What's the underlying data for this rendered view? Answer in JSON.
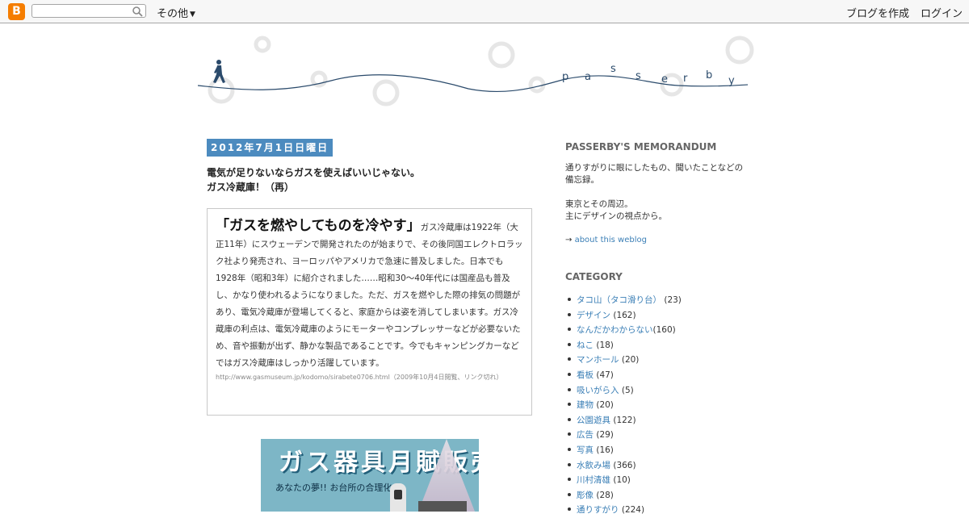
{
  "navbar": {
    "logo": "B",
    "search_placeholder": "",
    "more_label": "その他",
    "create_blog_label": "ブログを作成",
    "login_label": "ログイン"
  },
  "header": {
    "title": "p   a   s   s   e   r   b   y"
  },
  "post": {
    "date": "2012年7月1日日曜日",
    "title_line1": "電気が足りないならガスを使えばいいじゃない。",
    "title_line2": "ガス冷蔵庫！（再）",
    "quote_lead": "「ガスを燃やしてものを冷やす」",
    "quote_body": "ガス冷蔵庫は1922年（大正11年）にスウェーデンで開発されたのが始まりで、その後同国エレクトロラック社より発売され、ヨーロッパやアメリカで急速に普及しました。日本でも1928年（昭和3年）に紹介されました……昭和30～40年代には国産品も普及し、かなり使われるようになりました。ただ、ガスを燃やした際の排気の問題があり、電気冷蔵庫が登場してくると、家庭からは姿を消してしまいます。ガス冷蔵庫の利点は、電気冷蔵庫のようにモーターやコンプレッサーなどが必要ないため、音や振動が出ず、静かな製品であることです。今でもキャンピングカーなどではガス冷蔵庫はしっかり活躍しています。",
    "quote_source": "http://www.gasmuseum.jp/kodomo/sirabete0706.html（2009年10月4日閲覧、リンク切れ）",
    "poster_title": "ガス器具月賦販売",
    "poster_sub": "あなたの夢!! お台所の合理化を"
  },
  "sidebar": {
    "about_title": "PASSERBY'S MEMORANDUM",
    "about_line1": "通りすがりに眼にしたもの、聞いたことなどの備忘録。",
    "about_line2": "東京とその周辺。",
    "about_line3": "主にデザインの視点から。",
    "about_arrow": "→",
    "about_link": "about this weblog",
    "category_title": "CATEGORY",
    "categories": [
      {
        "name": "タコ山（タコ滑り台）",
        "count": "(23)"
      },
      {
        "name": "デザイン",
        "count": "(162)"
      },
      {
        "name": "なんだかわからない",
        "count": "(160)"
      },
      {
        "name": "ねこ",
        "count": "(18)"
      },
      {
        "name": "マンホール",
        "count": "(20)"
      },
      {
        "name": "看板",
        "count": "(47)"
      },
      {
        "name": "吸いがら入",
        "count": "(5)"
      },
      {
        "name": "建物",
        "count": "(20)"
      },
      {
        "name": "公園遊具",
        "count": "(122)"
      },
      {
        "name": "広告",
        "count": "(29)"
      },
      {
        "name": "写真",
        "count": "(16)"
      },
      {
        "name": "水飲み場",
        "count": "(366)"
      },
      {
        "name": "川村清雄",
        "count": "(10)"
      },
      {
        "name": "彫像",
        "count": "(28)"
      },
      {
        "name": "通りすがり",
        "count": "(224)"
      }
    ]
  },
  "colors": {
    "date_bg": "#4c8bbf",
    "link": "#3b7fb6",
    "logo_orange": "#f57d00",
    "wave": "#2a4a6b"
  }
}
